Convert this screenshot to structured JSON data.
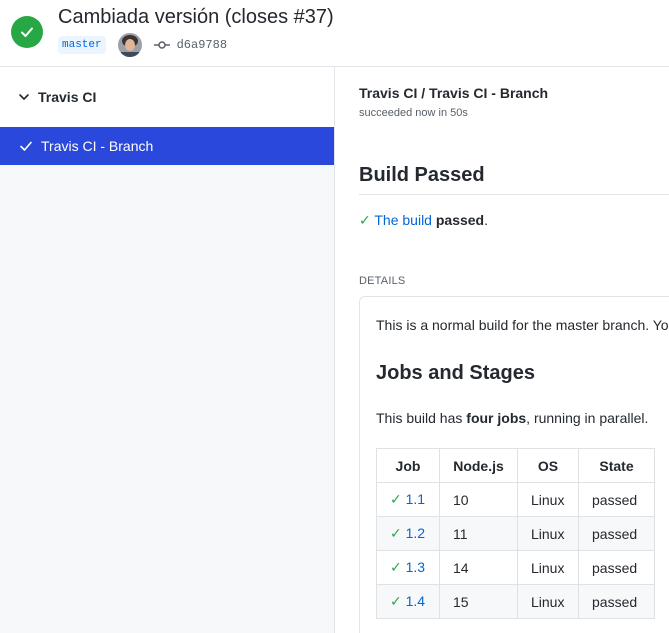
{
  "header": {
    "title": "Cambiada versión (closes #37)",
    "branch": "master",
    "commit_sha": "d6a9788",
    "status_icon": "check-circle-icon",
    "status_color": "#28a745"
  },
  "sidebar": {
    "suite_name": "Travis CI",
    "checks": [
      {
        "label": "Travis CI - Branch",
        "selected": true
      }
    ],
    "selected_bg": "#2a48db"
  },
  "main": {
    "check_run_title": "Travis CI / Travis CI - Branch",
    "check_run_status": "succeeded now in 50s",
    "build_heading": "Build Passed",
    "summary": {
      "check": "✓",
      "link_text": "The build",
      "status_word": "passed",
      "period": "."
    },
    "details_label": "DETAILS",
    "details_text": "This is a normal build for the master branch. Yo",
    "jobs_heading": "Jobs and Stages",
    "jobs_text": {
      "pre": "This build has ",
      "bold": "four jobs",
      "post": ", running in parallel."
    },
    "table": {
      "headers": [
        "Job",
        "Node.js",
        "OS",
        "State"
      ],
      "rows": [
        {
          "job": "1.1",
          "node": "10",
          "os": "Linux",
          "state": "passed"
        },
        {
          "job": "1.2",
          "node": "11",
          "os": "Linux",
          "state": "passed"
        },
        {
          "job": "1.3",
          "node": "14",
          "os": "Linux",
          "state": "passed"
        },
        {
          "job": "1.4",
          "node": "15",
          "os": "Linux",
          "state": "passed"
        }
      ]
    }
  },
  "colors": {
    "success": "#28a745",
    "link": "#0366d6"
  }
}
